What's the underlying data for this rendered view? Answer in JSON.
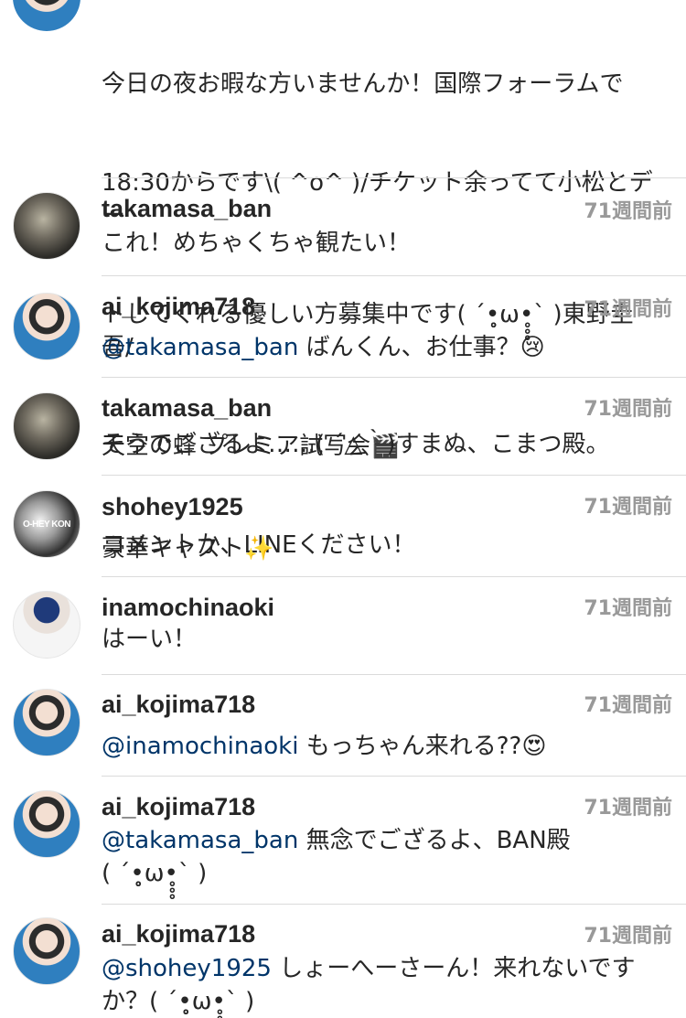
{
  "top_comment": {
    "lines": [
      "今日の夜お暇な方いませんか！国際フォーラムで",
      "18:30からです\\( ^o^ )/チケット余ってて小松とデー",
      "トしてくれる優しい方募集中です( ´•̥̥̥ω•̥̥̥` )東野圭吾/",
      "天空の蜂 プレミア試写会🎬",
      "コメントか、LINEください！"
    ]
  },
  "comments": [
    {
      "username": "takamasa_ban",
      "time": "71週間前",
      "mention": "",
      "text": "これ！めちゃくちゃ観たい！"
    },
    {
      "username": "ai_kojima718",
      "time": "71週間前",
      "mention": "@takamasa_ban",
      "text": " ばんくん、お仕事？😢"
    },
    {
      "username": "takamasa_ban",
      "time": "71週間前",
      "mention": "",
      "text": "そうでござるよ……( ´△｀)すまぬ、こまつ殿。"
    },
    {
      "username": "shohey1925",
      "time": "71週間前",
      "mention": "",
      "text": "豪華キャスト✨",
      "avatar_text": "O-HEY KON"
    },
    {
      "username": "inamochinaoki",
      "time": "71週間前",
      "mention": "",
      "text": "はーい！"
    },
    {
      "username": "ai_kojima718",
      "time": "71週間前",
      "mention": "@inamochinaoki",
      "text": " もっちゃん来れる??😍"
    },
    {
      "username": "ai_kojima718",
      "time": "71週間前",
      "mention": "@takamasa_ban",
      "text": " 無念でござるよ、BAN殿\n( ´•̥̥̥ω•̥̥̥` )"
    },
    {
      "username": "ai_kojima718",
      "time": "71週間前",
      "mention": "@shohey1925",
      "text": " しょーへーさーん！来れないです\nか？( ´•̥̥̥ω•̥̥̥` )"
    }
  ]
}
